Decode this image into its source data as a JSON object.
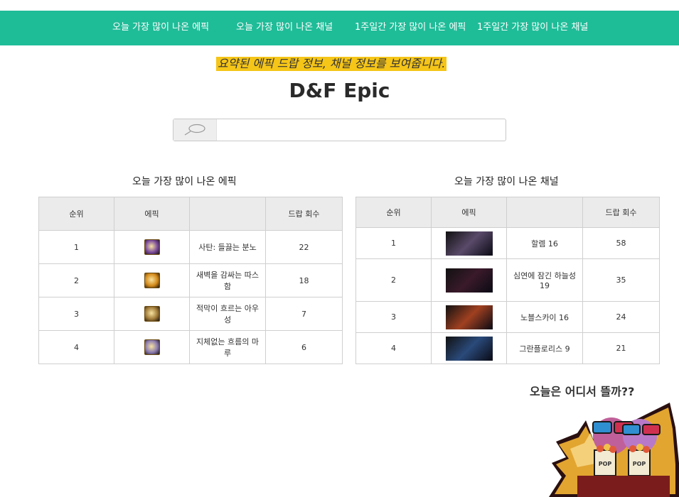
{
  "nav": {
    "items": [
      {
        "label": "오늘 가장 많이 나온 에픽"
      },
      {
        "label": "오늘 가장 많이 나온 채널"
      },
      {
        "label": "1주일간 가장 많이 나온 에픽"
      },
      {
        "label": "1주일간 가장 많이 나온 채널"
      }
    ]
  },
  "header": {
    "subtitle": "요약된 에픽 드랍 정보, 채널 정보를 보여줍니다.",
    "title": "D&F Epic"
  },
  "search": {
    "icon": "search-icon",
    "value": "",
    "placeholder": ""
  },
  "epics": {
    "title": "오늘 가장 많이 나온 에픽",
    "columns": [
      "순위",
      "에픽",
      "",
      "드랍 회수"
    ],
    "rows": [
      {
        "rank": "1",
        "name": "사탄: 들끓는 분노",
        "count": "22",
        "icon_color": "#7a4a9c"
      },
      {
        "rank": "2",
        "name": "새벽을 감싸는 따스함",
        "count": "18",
        "icon_color": "#d48a1a"
      },
      {
        "rank": "3",
        "name": "적막이 흐르는 아우성",
        "count": "7",
        "icon_color": "#a07a38"
      },
      {
        "rank": "4",
        "name": "지체없는 흐름의 마루",
        "count": "6",
        "icon_color": "#8a7ab0"
      }
    ]
  },
  "channels": {
    "title": "오늘 가장 많이 나온 채널",
    "columns": [
      "순위",
      "에픽",
      "",
      "드랍 회수"
    ],
    "rows": [
      {
        "rank": "1",
        "name": "할렘 16",
        "count": "58",
        "thumb_color": "#5a4a6a"
      },
      {
        "rank": "2",
        "name": "심연에 잠긴  하늘성 19",
        "count": "35",
        "thumb_color": "#3a1a2a"
      },
      {
        "rank": "3",
        "name": "노블스카이 16",
        "count": "24",
        "thumb_color": "#a04020"
      },
      {
        "rank": "4",
        "name": "그란플로리스 9",
        "count": "21",
        "thumb_color": "#2a4a7a"
      }
    ]
  },
  "promo": {
    "text": "오늘은 어디서 뜰까??",
    "image": "characters-eating-popcorn-illustration",
    "popcorn_label": "POP"
  },
  "colors": {
    "navbar": "#1fbc98",
    "highlight": "#f5c518",
    "table_header": "#ebebeb"
  }
}
